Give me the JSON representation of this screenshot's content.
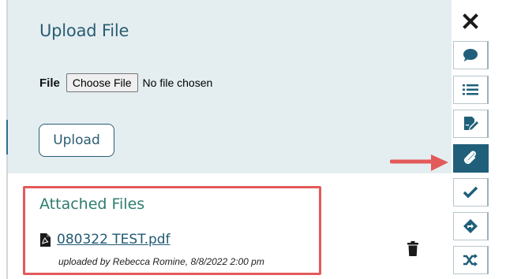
{
  "upload_panel": {
    "title": "Upload File",
    "file_label": "File",
    "choose_button_label": "Choose File",
    "no_file_text": "No file chosen",
    "upload_button_label": "Upload"
  },
  "attached_files": {
    "title": "Attached Files",
    "files": [
      {
        "name": "080322 TEST.pdf",
        "uploaded_by": "uploaded by Rebecca Romine,  8/8/2022 2:00 pm"
      }
    ]
  },
  "toolbar": {
    "items": [
      {
        "icon": "close-icon"
      },
      {
        "icon": "comment-icon"
      },
      {
        "icon": "list-icon"
      },
      {
        "icon": "signature-icon"
      },
      {
        "icon": "paperclip-icon",
        "active": true
      },
      {
        "icon": "check-icon"
      },
      {
        "icon": "route-icon"
      },
      {
        "icon": "shuffle-icon"
      }
    ]
  },
  "colors": {
    "accent": "#1f5f7a",
    "annotation_red": "#e35a5a",
    "panel_bg": "#e4eef1",
    "attached_title": "#2e7d6e"
  }
}
